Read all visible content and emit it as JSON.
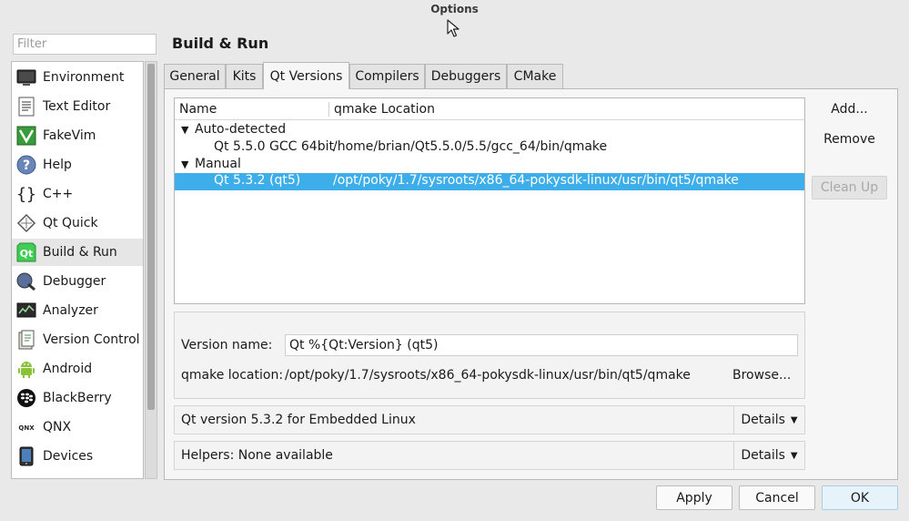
{
  "window": {
    "title": "Options"
  },
  "filter": {
    "placeholder": "Filter",
    "value": ""
  },
  "sidebar": {
    "items": [
      {
        "label": "Environment",
        "icon": "monitor-icon"
      },
      {
        "label": "Text Editor",
        "icon": "text-editor-icon"
      },
      {
        "label": "FakeVim",
        "icon": "fakevim-icon"
      },
      {
        "label": "Help",
        "icon": "help-icon"
      },
      {
        "label": "C++",
        "icon": "braces-icon"
      },
      {
        "label": "Qt Quick",
        "icon": "qt-quick-icon"
      },
      {
        "label": "Build & Run",
        "icon": "build-run-icon"
      },
      {
        "label": "Debugger",
        "icon": "debugger-icon"
      },
      {
        "label": "Analyzer",
        "icon": "analyzer-icon"
      },
      {
        "label": "Version Control",
        "icon": "version-control-icon"
      },
      {
        "label": "Android",
        "icon": "android-icon"
      },
      {
        "label": "BlackBerry",
        "icon": "blackberry-icon"
      },
      {
        "label": "QNX",
        "icon": "qnx-icon"
      },
      {
        "label": "Devices",
        "icon": "devices-icon"
      }
    ],
    "selected": "Build & Run"
  },
  "page": {
    "title": "Build & Run"
  },
  "tabs": [
    {
      "label": "General"
    },
    {
      "label": "Kits"
    },
    {
      "label": "Qt Versions"
    },
    {
      "label": "Compilers"
    },
    {
      "label": "Debuggers"
    },
    {
      "label": "CMake"
    }
  ],
  "active_tab": "Qt Versions",
  "tree": {
    "headers": [
      "Name",
      "qmake Location"
    ],
    "groups": [
      {
        "label": "Auto-detected",
        "rows": [
          {
            "name": "Qt 5.5.0 GCC 64bit",
            "location": "/home/brian/Qt5.5.0/5.5/gcc_64/bin/qmake"
          }
        ]
      },
      {
        "label": "Manual",
        "rows": [
          {
            "name": "Qt 5.3.2 (qt5)",
            "location": "/opt/poky/1.7/sysroots/x86_64-pokysdk-linux/usr/bin/qt5/qmake"
          }
        ]
      }
    ]
  },
  "buttons": {
    "add": "Add...",
    "remove": "Remove",
    "clean_up": "Clean Up"
  },
  "details": {
    "version_name_label": "Version name:",
    "version_name_value": "Qt %{Qt:Version} (qt5)",
    "qmake_location_label": "qmake location:",
    "qmake_location_value": "/opt/poky/1.7/sysroots/x86_64-pokysdk-linux/usr/bin/qt5/qmake",
    "browse": "Browse..."
  },
  "info_row": {
    "text": "Qt version 5.3.2 for Embedded Linux",
    "details": "Details"
  },
  "helpers_row": {
    "text": "Helpers: None available",
    "details": "Details"
  },
  "footer": {
    "apply": "Apply",
    "cancel": "Cancel",
    "ok": "OK"
  },
  "colors": {
    "selection": "#3daee9",
    "ok_button": "#e7f3fb"
  }
}
